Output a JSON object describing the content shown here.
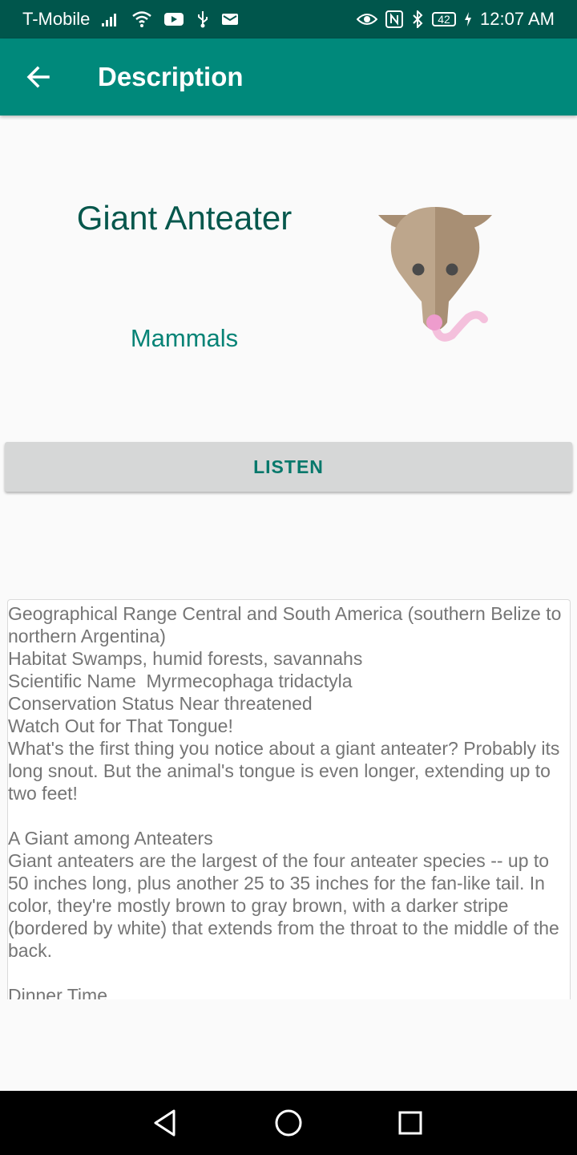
{
  "status_bar": {
    "carrier": "T-Mobile",
    "battery": "42",
    "time": "12:07 AM",
    "icons": [
      "signal-icon",
      "wifi-icon",
      "youtube-icon",
      "usb-icon",
      "mail-icon",
      "eye-icon",
      "nfc-icon",
      "bluetooth-icon",
      "battery-icon",
      "charging-icon"
    ]
  },
  "app_bar": {
    "title": "Description",
    "back_icon": "back-arrow-icon"
  },
  "animal": {
    "name": "Giant Anteater",
    "category": "Mammals",
    "image_icon": "anteater-icon",
    "colors": {
      "face_light": "#bda68c",
      "face_dark": "#a88f74",
      "eyes": "#4a4a4a",
      "tongue": "#f4c0dc",
      "tongue_tip": "#ee9ccd"
    }
  },
  "listen_button": {
    "label": "LISTEN"
  },
  "description": {
    "text": "Geographical Range Central and South America (southern Belize to northern Argentina)\nHabitat Swamps, humid forests, savannahs\nScientific Name  Myrmecophaga tridactyla\nConservation Status Near threatened\nWatch Out for That Tongue!\nWhat's the first thing you notice about a giant anteater? Probably its long snout. But the animal's tongue is even longer, extending up to two feet!\n\nA Giant among Anteaters\nGiant anteaters are the largest of the four anteater species -- up to 50 inches long, plus another 25 to 35 inches for the fan-like tail. In color, they're mostly brown to gray brown, with a darker stripe (bordered by white) that extends from the throat to the middle of the back.\n\nDinner Time"
  },
  "nav_bar": {
    "icons": [
      "back-triangle-icon",
      "home-circle-icon",
      "recents-square-icon"
    ]
  },
  "colors": {
    "status_bar": "#00564c",
    "app_bar": "#00897b",
    "name_text": "#06574c",
    "accent_text": "#068376",
    "button_bg": "#d6d7d7",
    "description_text": "#757575"
  }
}
